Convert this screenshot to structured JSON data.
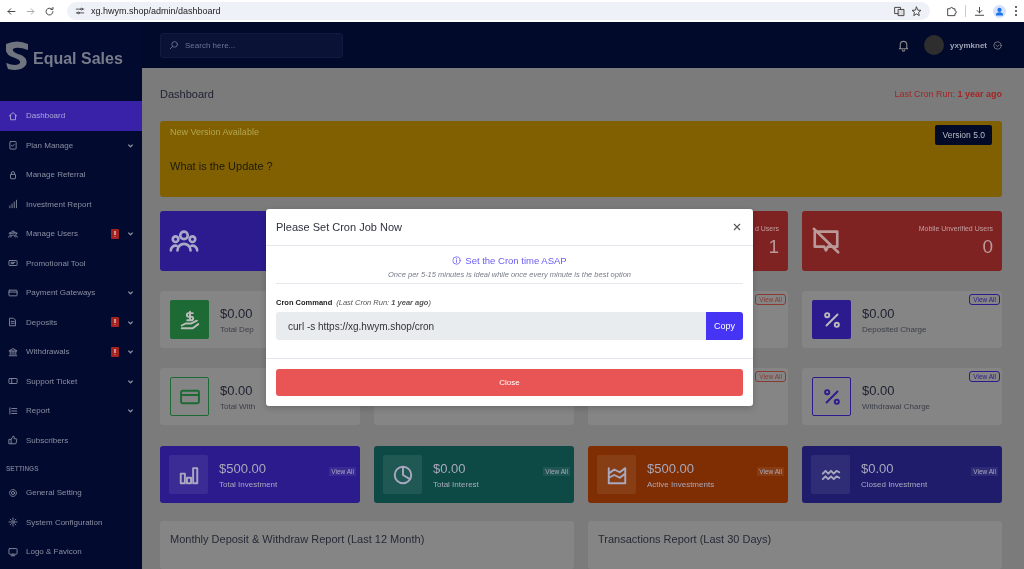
{
  "browser": {
    "url": "xg.hwym.shop/admin/dashboard"
  },
  "brand": "Equal Sales",
  "search": {
    "placeholder": "Search here..."
  },
  "user": {
    "name": "yxymknet"
  },
  "sidebar": {
    "items": [
      {
        "label": "Dashboard",
        "selected": true,
        "alert": false,
        "submenu": false
      },
      {
        "label": "Plan Manage",
        "selected": false,
        "alert": false,
        "submenu": true
      },
      {
        "label": "Manage Referral",
        "selected": false,
        "alert": false,
        "submenu": false
      },
      {
        "label": "Investment Report",
        "selected": false,
        "alert": false,
        "submenu": false
      },
      {
        "label": "Manage Users",
        "selected": false,
        "alert": true,
        "submenu": true
      },
      {
        "label": "Promotional Tool",
        "selected": false,
        "alert": false,
        "submenu": false
      },
      {
        "label": "Payment Gateways",
        "selected": false,
        "alert": false,
        "submenu": true
      },
      {
        "label": "Deposits",
        "selected": false,
        "alert": true,
        "submenu": true
      },
      {
        "label": "Withdrawals",
        "selected": false,
        "alert": true,
        "submenu": true
      },
      {
        "label": "Support Ticket",
        "selected": false,
        "alert": false,
        "submenu": true
      },
      {
        "label": "Report",
        "selected": false,
        "alert": false,
        "submenu": true
      },
      {
        "label": "Subscribers",
        "selected": false,
        "alert": false,
        "submenu": false
      }
    ],
    "section": "SETTINGS",
    "settings_items": [
      {
        "label": "General Setting",
        "selected": false,
        "alert": false,
        "submenu": false
      },
      {
        "label": "System Configuration",
        "selected": false,
        "alert": false,
        "submenu": false
      },
      {
        "label": "Logo & Favicon",
        "selected": false,
        "alert": false,
        "submenu": false
      }
    ]
  },
  "page": {
    "title": "Dashboard",
    "cron_status": "Last Cron Run: **1 year ago**"
  },
  "update_banner": {
    "heading": "New Version Available",
    "question": "What is the Update ?",
    "version": "Version 5.0"
  },
  "user_cards": [
    {
      "kind": "icon_only",
      "color": "#2b1b8e"
    },
    {
      "kind": "partial",
      "label": "d Users",
      "value": "1",
      "color": "#7e2222"
    },
    {
      "kind": "full",
      "label": "Mobile Unverified Users",
      "value": "0",
      "color": "#7e2222"
    }
  ],
  "finance_rows": [
    [
      {
        "kind": "stat",
        "value": "$0.00",
        "label": "Total Dep",
        "filled": true,
        "color": "#1d6a35"
      },
      {
        "kind": "badge_only",
        "view_all": "View All",
        "color": "#8a3a30"
      },
      {
        "kind": "stat",
        "value": "$0.00",
        "label": "Deposited Charge",
        "filled": true,
        "color": "#2b1b8e",
        "view_all": "View All"
      }
    ],
    [
      {
        "kind": "stat",
        "value": "$0.00",
        "label": "Total With",
        "filled": false,
        "color": "#1d6a35"
      },
      {
        "kind": "badge_only",
        "view_all": "View All",
        "color": "#8a3a30"
      },
      {
        "kind": "stat",
        "value": "$0.00",
        "label": "Withdrawal Charge",
        "filled": false,
        "color": "#2b1b8e",
        "view_all": "View All"
      }
    ]
  ],
  "investment_cards": [
    {
      "value": "$500.00",
      "label": "Total Investment",
      "view_all": "View All",
      "color": "#2b1b8c"
    },
    {
      "value": "$0.00",
      "label": "Total Interest",
      "view_all": "View All",
      "color": "#0e4a45"
    },
    {
      "value": "$500.00",
      "label": "Active Investments",
      "view_all": "View All",
      "color": "#7e2e02"
    },
    {
      "value": "$0.00",
      "label": "Closed Investment",
      "view_all": "View All",
      "color": "#1f1c6c"
    }
  ],
  "reports": [
    {
      "title": "Monthly Deposit & Withdraw Report (Last 12 Month)"
    },
    {
      "title": "Transactions Report (Last 30 Days)"
    }
  ],
  "modal": {
    "title": "Please Set Cron Job Now",
    "notice": "Set the Cron time ASAP",
    "note": "Once per 5-15 minutes is ideal while once every minute is the best option",
    "field_label": "Cron Command",
    "field_hint": "(Last Cron Run: **1 year ago**)",
    "command": "curl -s https://xg.hwym.shop/cron",
    "copy": "Copy",
    "close": "Close"
  }
}
